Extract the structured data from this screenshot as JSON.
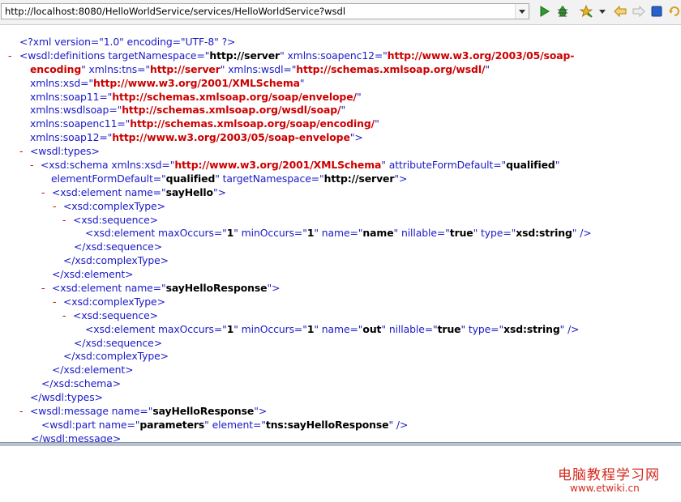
{
  "address_bar": {
    "url": "http://localhost:8080/HelloWorldService/services/HelloWorldService?wsdl"
  },
  "toolbar": {
    "buttons": [
      "go-icon",
      "debug-icon",
      "favorites-icon",
      "back-icon",
      "forward-icon",
      "stop-icon",
      "refresh-icon"
    ]
  },
  "xml": {
    "l1": {
      "open": "<?xml version=\"1.0\" encoding=\"UTF-8\" ?>"
    },
    "l2": {
      "m": "-",
      "p1": "<wsdl:definitions targetNamespace=\"",
      "v1": "http://server",
      "p2": "\" xmlns:soapenc12=\"",
      "v2": "http://www.w3.org/2003/05/soap-"
    },
    "l3": {
      "v1": "encoding",
      "p1": "\" xmlns:tns=\"",
      "v2": "http://server",
      "p2": "\" xmlns:wsdl=\"",
      "v3": "http://schemas.xmlsoap.org/wsdl/",
      "p3": "\""
    },
    "l4": {
      "p1": "xmlns:xsd=\"",
      "v1": "http://www.w3.org/2001/XMLSchema",
      "p2": "\""
    },
    "l5": {
      "p1": "xmlns:soap11=\"",
      "v1": "http://schemas.xmlsoap.org/soap/envelope/",
      "p2": "\""
    },
    "l6": {
      "p1": "xmlns:wsdlsoap=\"",
      "v1": "http://schemas.xmlsoap.org/wsdl/soap/",
      "p2": "\""
    },
    "l7": {
      "p1": "xmlns:soapenc11=\"",
      "v1": "http://schemas.xmlsoap.org/soap/encoding/",
      "p2": "\""
    },
    "l8": {
      "p1": "xmlns:soap12=\"",
      "v1": "http://www.w3.org/2003/05/soap-envelope",
      "p2": "\">"
    },
    "l9": {
      "m": "-",
      "p1": "<wsdl:types>"
    },
    "l10": {
      "m": "-",
      "p1": "<xsd:schema xmlns:xsd=\"",
      "v1": "http://www.w3.org/2001/XMLSchema",
      "p2": "\" attributeFormDefault=\"",
      "v2": "qualified",
      "p3": "\""
    },
    "l11": {
      "p1": "elementFormDefault=\"",
      "v1": "qualified",
      "p2": "\" targetNamespace=\"",
      "v2": "http://server",
      "p3": "\">"
    },
    "l12": {
      "m": "-",
      "p1": "<xsd:element name=\"",
      "v1": "sayHello",
      "p2": "\">"
    },
    "l13": {
      "m": "-",
      "p1": "<xsd:complexType>"
    },
    "l14": {
      "m": "-",
      "p1": "<xsd:sequence>"
    },
    "l15": {
      "p1": "<xsd:element maxOccurs=\"",
      "v1": "1",
      "p2": "\" minOccurs=\"",
      "v2": "1",
      "p3": "\" name=\"",
      "v3": "name",
      "p4": "\" nillable=\"",
      "v4": "true",
      "p5": "\" type=\"",
      "v5": "xsd:string",
      "p6": "\" />"
    },
    "l16": {
      "p1": "</xsd:sequence>"
    },
    "l17": {
      "p1": "</xsd:complexType>"
    },
    "l18": {
      "p1": "</xsd:element>"
    },
    "l19": {
      "m": "-",
      "p1": "<xsd:element name=\"",
      "v1": "sayHelloResponse",
      "p2": "\">"
    },
    "l20": {
      "m": "-",
      "p1": "<xsd:complexType>"
    },
    "l21": {
      "m": "-",
      "p1": "<xsd:sequence>"
    },
    "l22": {
      "p1": "<xsd:element maxOccurs=\"",
      "v1": "1",
      "p2": "\" minOccurs=\"",
      "v2": "1",
      "p3": "\" name=\"",
      "v3": "out",
      "p4": "\" nillable=\"",
      "v4": "true",
      "p5": "\" type=\"",
      "v5": "xsd:string",
      "p6": "\" />"
    },
    "l23": {
      "p1": "</xsd:sequence>"
    },
    "l24": {
      "p1": "</xsd:complexType>"
    },
    "l25": {
      "p1": "</xsd:element>"
    },
    "l26": {
      "p1": "</xsd:schema>"
    },
    "l27": {
      "p1": "</wsdl:types>"
    },
    "l28": {
      "m": "-",
      "p1": "<wsdl:message name=\"",
      "v1": "sayHelloResponse",
      "p2": "\">"
    },
    "l29": {
      "p1": "<wsdl:part name=\"",
      "v1": "parameters",
      "p2": "\" element=\"",
      "v2": "tns:sayHelloResponse",
      "p3": "\" />"
    },
    "l30": {
      "p1": "</wsdl:message>"
    }
  },
  "watermark": {
    "title": "电脑教程学习网",
    "url": "www.etwiki.cn"
  },
  "colors": {
    "tag": "#1a1ac8",
    "value": "#000000",
    "url_value": "#cc0000",
    "collapse_marker": "#cc0000",
    "watermark": "#d42a1e"
  }
}
